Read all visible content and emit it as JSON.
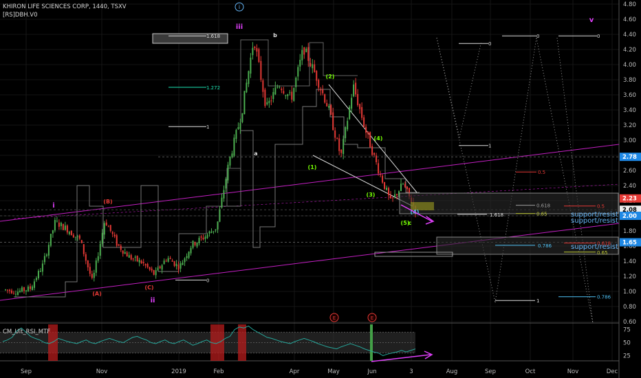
{
  "header": {
    "symbol_line": "KHIRON LIFE SCIENCES CORP, 1440, TSXV",
    "sub_line": "[RS]DBH.V0"
  },
  "indicator": {
    "title": "CM_Ult_RSI_MTF",
    "y_ticks": [
      "75",
      "50",
      "25"
    ]
  },
  "colors": {
    "background": "#000000",
    "candle_up": "#4caf50",
    "candle_down": "#e53935",
    "wave_pink": "#e040fb",
    "channel": "#c51fc5",
    "rsi_line": "#26a69a",
    "rsi_band": "#3a3a3a",
    "price_box": "#d0d0d0",
    "price_red": "#e53935",
    "price_blue": "#1e88e5",
    "support_text": "#64b5f6"
  },
  "chart_data": {
    "type": "line",
    "title": "KHIRON LIFE SCIENCES CORP, 1440, TSXV",
    "xlabel": "",
    "ylabel": "",
    "ylim": [
      0.6,
      4.8
    ],
    "x_ticks": [
      "Sep",
      "Nov",
      "2019",
      "Feb",
      "Apr",
      "May",
      "Jun",
      "3",
      "Aug",
      "Sep",
      "Oct",
      "Nov",
      "Dec"
    ],
    "y_ticks": [
      "4.80",
      "4.60",
      "4.40",
      "4.20",
      "4.00",
      "3.80",
      "3.60",
      "3.40",
      "3.20",
      "3.00",
      "2.80",
      "2.60",
      "2.40",
      "2.20",
      "2.00",
      "1.80",
      "1.60",
      "1.40",
      "1.20",
      "1.00",
      "0.80",
      "0.60"
    ],
    "price_tags": [
      {
        "label": "2.78",
        "value": 2.78,
        "style": "blue"
      },
      {
        "label": "2.23",
        "value": 2.23,
        "style": "red"
      },
      {
        "label": "2.08",
        "value": 2.08,
        "style": "white"
      },
      {
        "label": "2.00",
        "value": 2.0,
        "style": "blue"
      },
      {
        "label": "1.65",
        "value": 1.65,
        "style": "blue"
      }
    ],
    "series": [
      {
        "name": "",
        "x": [
          "Aug 15",
          "Aug 25",
          "Sep 5",
          "Sep 15",
          "Sep 25",
          "Oct 5",
          "Oct 15",
          "Oct 25",
          "Nov 5",
          "Nov 15",
          "Nov 25",
          "Dec 5",
          "Dec 15",
          "Dec 25",
          "Jan 1",
          "Jan 10",
          "Jan 20",
          "Jan 30",
          "Feb 5",
          "Feb 10",
          "Feb 18",
          "Feb 25",
          "Mar 5",
          "Mar 12",
          "Mar 20",
          "Apr 1",
          "Apr 10",
          "Apr 20",
          "May 1",
          "May 10",
          "May 20",
          "May 28",
          "Jun 3",
          "Jun 10"
        ],
        "values": [
          1.02,
          1.0,
          1.04,
          1.35,
          1.92,
          1.82,
          1.68,
          1.12,
          1.95,
          1.62,
          1.45,
          1.38,
          1.22,
          1.45,
          1.32,
          1.62,
          1.72,
          1.85,
          2.72,
          3.35,
          4.35,
          3.42,
          3.75,
          3.55,
          4.22,
          3.85,
          3.42,
          2.78,
          3.72,
          3.12,
          2.62,
          2.18,
          2.42,
          2.08
        ]
      }
    ],
    "wave_labels": [
      {
        "text": "i",
        "value": 2.08,
        "color": "pink"
      },
      {
        "text": "ii",
        "value": 1.0,
        "color": "pink"
      },
      {
        "text": "iii",
        "value": 4.52,
        "color": "pink"
      },
      {
        "text": "v",
        "value": 4.6,
        "color": "pink"
      },
      {
        "text": "(A)",
        "value": 1.16,
        "color": "red"
      },
      {
        "text": "(B)",
        "value": 2.05,
        "color": "red"
      },
      {
        "text": "(C)",
        "value": 1.22,
        "color": "red"
      },
      {
        "text": "a",
        "value": 2.88,
        "color": "white"
      },
      {
        "text": "b",
        "value": 4.42,
        "color": "white"
      },
      {
        "text": "(1)",
        "value": 2.6,
        "color": "green"
      },
      {
        "text": "(2)",
        "value": 3.9,
        "color": "green"
      },
      {
        "text": "(3)",
        "value": 2.28,
        "color": "green"
      },
      {
        "text": "(4)",
        "value": 3.02,
        "color": "green"
      },
      {
        "text": "(5)",
        "value": 1.9,
        "color": "green"
      },
      {
        "text": "c",
        "value": 1.9,
        "color": "green"
      },
      {
        "text": "(4)",
        "value": 2.07,
        "color": "blue"
      }
    ],
    "fib_labels": [
      {
        "text": "1.618",
        "value": 4.38
      },
      {
        "text": "1.272",
        "value": 3.7
      },
      {
        "text": "1",
        "value": 3.18
      },
      {
        "text": "0",
        "value": 1.15
      },
      {
        "text": "0",
        "value": 4.28
      },
      {
        "text": "0",
        "value": 4.38
      },
      {
        "text": "0",
        "value": 4.38
      },
      {
        "text": "1",
        "value": 2.93
      },
      {
        "text": "0.5",
        "value": 2.58
      },
      {
        "text": "0.618",
        "value": 2.14
      },
      {
        "text": "0.65",
        "value": 2.03
      },
      {
        "text": "1.618",
        "value": 2.02
      },
      {
        "text": "0.5",
        "value": 2.13
      },
      {
        "text": "0.618",
        "value": 1.64
      },
      {
        "text": "0.786",
        "value": 1.61
      },
      {
        "text": "0.65",
        "value": 1.52
      },
      {
        "text": "1",
        "value": 0.88
      },
      {
        "text": "0.786",
        "value": 0.93
      }
    ],
    "annotations": [
      "support/resist",
      "support/resist",
      "support/resist"
    ],
    "rsi": {
      "ylim": [
        15,
        85
      ],
      "overbought": 70,
      "oversold": 30,
      "values": [
        52,
        55,
        60,
        72,
        78,
        70,
        62,
        58,
        55,
        50,
        48,
        52,
        58,
        55,
        52,
        50,
        48,
        52,
        55,
        50,
        48,
        52,
        55,
        58,
        55,
        52,
        50,
        55,
        60,
        62,
        58,
        55,
        50,
        48,
        52,
        55,
        50,
        48,
        52,
        55,
        50,
        45,
        48,
        52,
        55,
        50,
        48,
        52,
        58,
        62,
        75,
        80,
        78,
        82,
        75,
        70,
        65,
        60,
        58,
        55,
        52,
        50,
        48,
        52,
        55,
        58,
        55,
        52,
        48,
        45,
        42,
        40,
        38,
        42,
        45,
        48,
        45,
        42,
        38,
        35,
        32,
        30,
        25,
        28,
        30,
        32,
        35,
        32,
        35,
        38
      ]
    },
    "event_markers": [
      "E",
      "E"
    ]
  }
}
